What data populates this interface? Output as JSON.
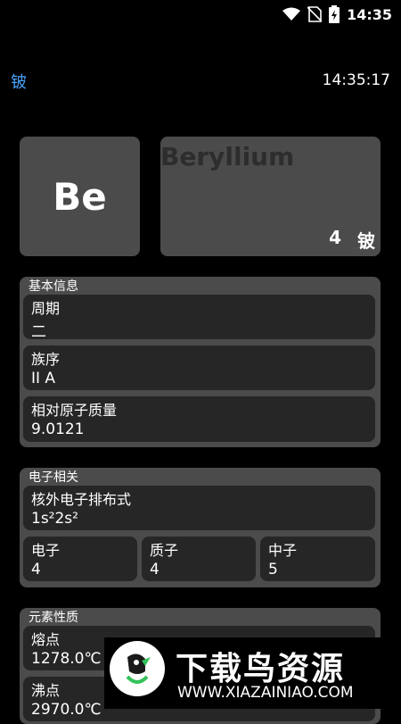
{
  "status": {
    "time": "14:35",
    "icons": [
      "wifi-icon",
      "no-sim-icon",
      "battery-charging-icon"
    ]
  },
  "app": {
    "title": "铍",
    "clock": "14:35:17"
  },
  "element": {
    "symbol": "Be",
    "name": "Beryllium",
    "number": "4",
    "cn_name": "铍"
  },
  "basic": {
    "title": "基本信息",
    "period": {
      "label": "周期",
      "value": "二"
    },
    "group": {
      "label": "族序",
      "value": "II A"
    },
    "mass": {
      "label": "相对原子质量",
      "value": "9.0121"
    }
  },
  "electron": {
    "title": "电子相关",
    "config": {
      "label": "核外电子排布式",
      "value": "1s²2s²"
    },
    "electrons": {
      "label": "电子",
      "value": "4"
    },
    "protons": {
      "label": "质子",
      "value": "4"
    },
    "neutrons": {
      "label": "中子",
      "value": "5"
    }
  },
  "properties": {
    "title": "元素性质",
    "melting": {
      "label": "熔点",
      "value": "1278.0℃"
    },
    "boiling": {
      "label": "沸点",
      "value": "2970.0℃"
    }
  },
  "watermark": {
    "text": "下载鸟资源",
    "url": "WWW.XIAZAINIAO.COM"
  }
}
